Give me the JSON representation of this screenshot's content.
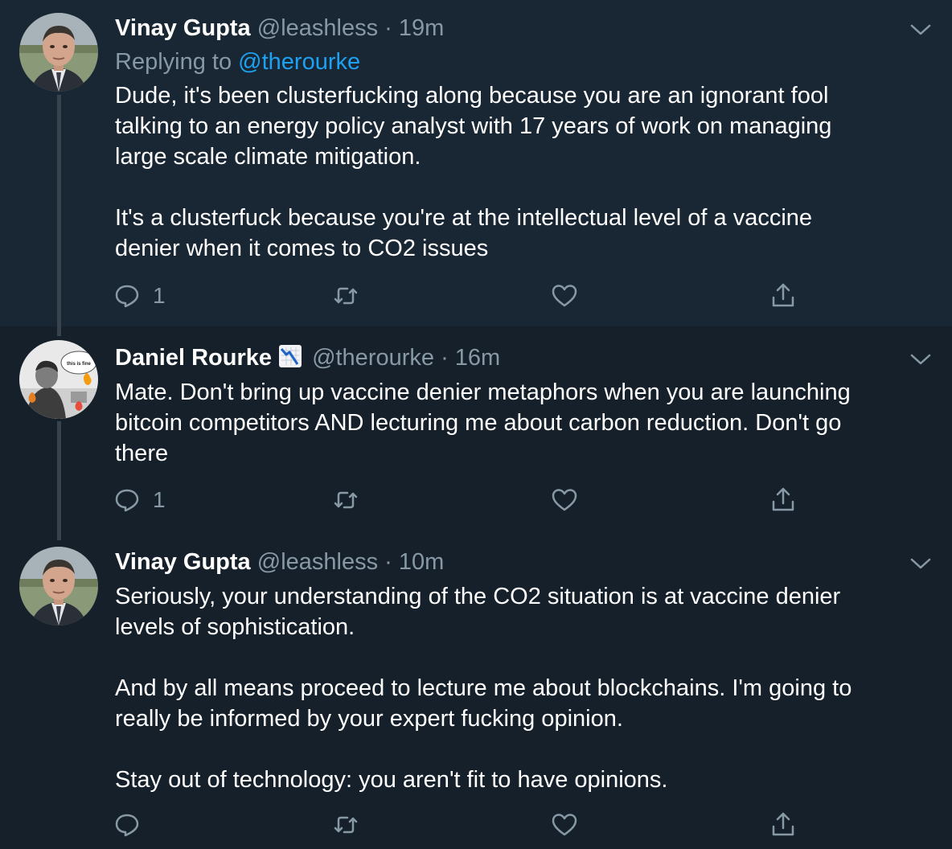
{
  "tweets": [
    {
      "author_name": "Vinay Gupta",
      "handle": "@leashless",
      "time": "· 19m",
      "replying_label": "Replying to",
      "replying_to": "@therourke",
      "text": "Dude, it's been clusterfucking along because you are an ignorant fool\ntalking to an energy policy analyst with 17 years of work on managing\nlarge scale climate mitigation.\n\nIt's a clusterfuck because you're at the intellectual level of a vaccine\ndenier when it comes to CO2 issues",
      "reply_count": "1",
      "avatar": "man-portrait-avatar"
    },
    {
      "author_name": "Daniel Rourke",
      "handle": "@therourke",
      "time": "· 16m",
      "badge_icon": "chart-decreasing-emoji",
      "text": "Mate. Don't bring up vaccine denier metaphors when you are launching\nbitcoin competitors AND lecturing me about carbon reduction. Don't go\nthere",
      "reply_count": "1",
      "avatar": "this-is-fine-avatar",
      "avatar_text": "this is fine"
    },
    {
      "author_name": "Vinay Gupta",
      "handle": "@leashless",
      "time": "· 10m",
      "text": "Seriously, your understanding of the CO2 situation is at vaccine denier\nlevels of sophistication.\n\nAnd by all means proceed to lecture me about blockchains. I'm going to\nreally be informed by your expert fucking opinion.\n\nStay out of technology: you aren't fit to have opinions.",
      "reply_count": "",
      "avatar": "man-portrait-avatar"
    }
  ],
  "colors": {
    "background": "#15202b",
    "highlight_background": "#192734",
    "muted_text": "#8899a6",
    "link": "#1da1f2",
    "thread_line": "#38444d"
  },
  "icons": [
    "reply-icon",
    "retweet-icon",
    "like-icon",
    "share-icon",
    "chevron-down-icon"
  ]
}
